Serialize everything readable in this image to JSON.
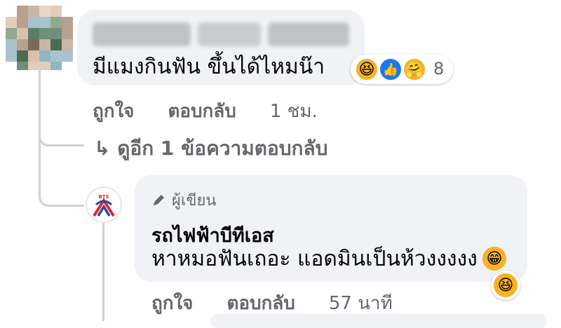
{
  "comment": {
    "author_name": "",
    "text": "มีแมงกินฟัน ขึ้นได้ไหมน๊า",
    "reactions": {
      "types": [
        "haha-icon",
        "like-icon",
        "care-icon"
      ],
      "count": "8"
    },
    "actions": {
      "like": "ถูกใจ",
      "reply": "ตอบกลับ",
      "time": "1 ชม."
    }
  },
  "view_more_replies": "↳ ดูอีก 1 ข้อความตอบกลับ",
  "reply": {
    "author_badge": "ผู้เขียน",
    "author_name": "รถไฟฟ้าบีทีเอส",
    "text": "หาหมอฟันเถอะ แอดมินเป็นห้วงงงงง",
    "inline_emoji": "😁",
    "reaction_emoji": "😆",
    "actions": {
      "like": "ถูกใจ",
      "reply": "ตอบกลับ",
      "time": "57 นาที"
    }
  },
  "avatar_logo_text": "BTS",
  "colors": {
    "bubble": "#f0f2f5",
    "secondary_text": "#65676b",
    "like_blue": "#1877f2",
    "emoji_yellow": "#f7b125",
    "bts_red": "#e4252c",
    "bts_blue": "#1f4e9e"
  }
}
